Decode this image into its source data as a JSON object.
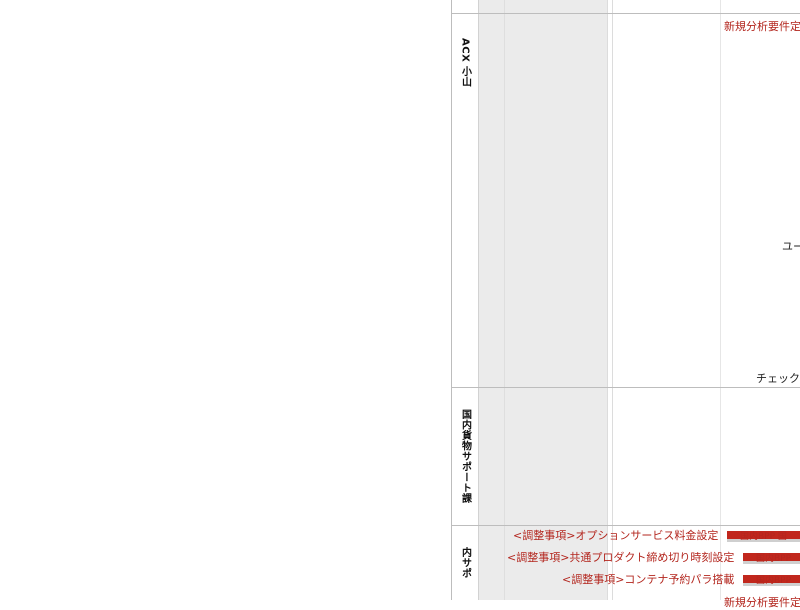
{
  "lanes": [
    {
      "label": "ACX 小山"
    },
    {
      "label": "国内貨物サポート課"
    },
    {
      "label": "内サポ"
    }
  ],
  "texts": {
    "top_right_red": "新規分析要件定",
    "mid_right": "ユー",
    "check": "チェック"
  },
  "tasks": [
    {
      "label": "<調整事項>オプションサービス料金設定",
      "bar_text": "国内BPP 国"
    },
    {
      "label": "<調整事項>共通プロダクト締め切り時刻設定",
      "bar_text": "国内BPP"
    },
    {
      "label": "<調整事項>コンテナ予約パラ搭載",
      "bar_text": "国内BPP"
    }
  ],
  "bottom_clip": "新規分析要件定",
  "colors": {
    "accent_red": "#c1271d",
    "shade": "#ebebeb"
  }
}
